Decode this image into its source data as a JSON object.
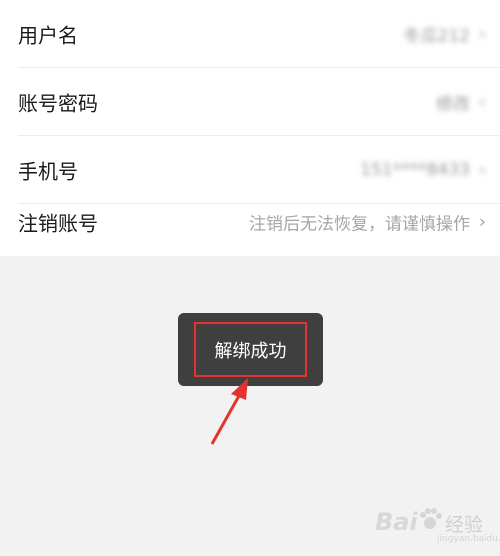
{
  "settings": {
    "rows": [
      {
        "label": "用户名",
        "value": "冬瓜212"
      },
      {
        "label": "账号密码",
        "value": "修改"
      },
      {
        "label": "手机号",
        "value": "151****8433"
      },
      {
        "label": "注销账号",
        "value": "注销后无法恢复，请谨慎操作"
      }
    ]
  },
  "toast": {
    "text": "解绑成功"
  },
  "watermark": {
    "logo": "Bai",
    "brand": "经验",
    "url": "jingyan.baidu.com"
  },
  "colors": {
    "highlight": "#e5322d",
    "toast_bg": "#3f3f3f"
  }
}
